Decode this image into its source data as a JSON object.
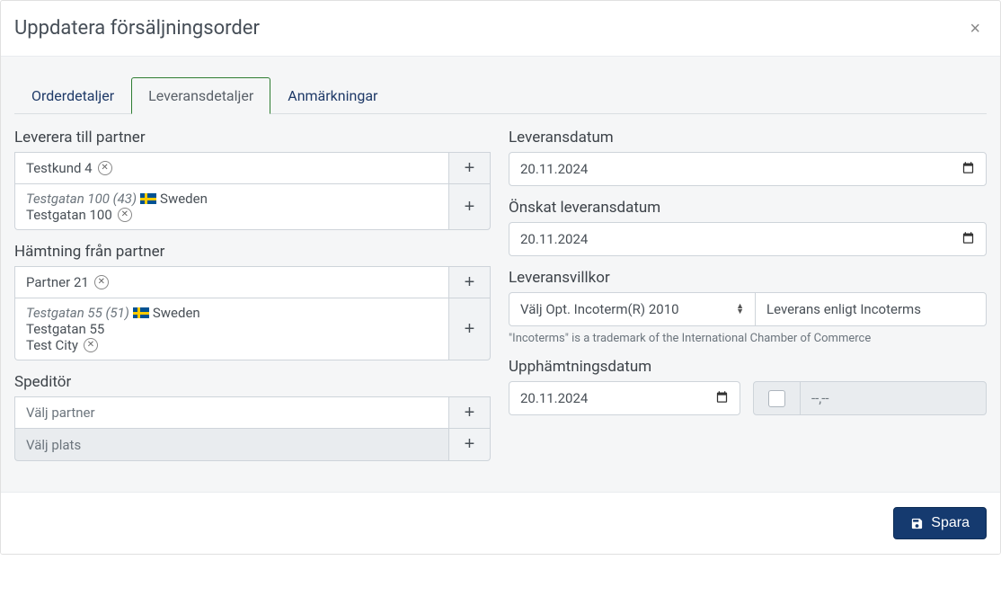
{
  "modal": {
    "title": "Uppdatera försäljningsorder",
    "close_label": "×"
  },
  "tabs": {
    "order_details": "Orderdetaljer",
    "delivery_details": "Leveransdetaljer",
    "notes": "Anmärkningar"
  },
  "left": {
    "deliver_to": {
      "label": "Leverera till partner",
      "partner": "Testkund 4",
      "address_title": "Testgatan 100 (43)",
      "country": "Sweden",
      "street": "Testgatan 100"
    },
    "pickup_from": {
      "label": "Hämtning från partner",
      "partner": "Partner 21",
      "address_title": "Testgatan 55 (51)",
      "country": "Sweden",
      "street": "Testgatan 55",
      "city": "Test City"
    },
    "forwarder": {
      "label": "Speditör",
      "partner_placeholder": "Välj partner",
      "location_placeholder": "Välj plats"
    },
    "add_symbol": "+"
  },
  "right": {
    "delivery_date": {
      "label": "Leveransdatum",
      "value": "20.11.2024"
    },
    "desired_date": {
      "label": "Önskat leveransdatum",
      "value": "20.11.2024"
    },
    "terms": {
      "label": "Leveransvillkor",
      "select_placeholder": "Välj Opt. Incoterm(R) 2010",
      "text_value": "Leverans enligt Incoterms",
      "helper": "\"Incoterms\" is a trademark of the International Chamber of Commerce"
    },
    "pickup_date": {
      "label": "Upphämtningsdatum",
      "value": "20.11.2024",
      "amount_placeholder": "--,--"
    }
  },
  "footer": {
    "save": "Spara"
  }
}
